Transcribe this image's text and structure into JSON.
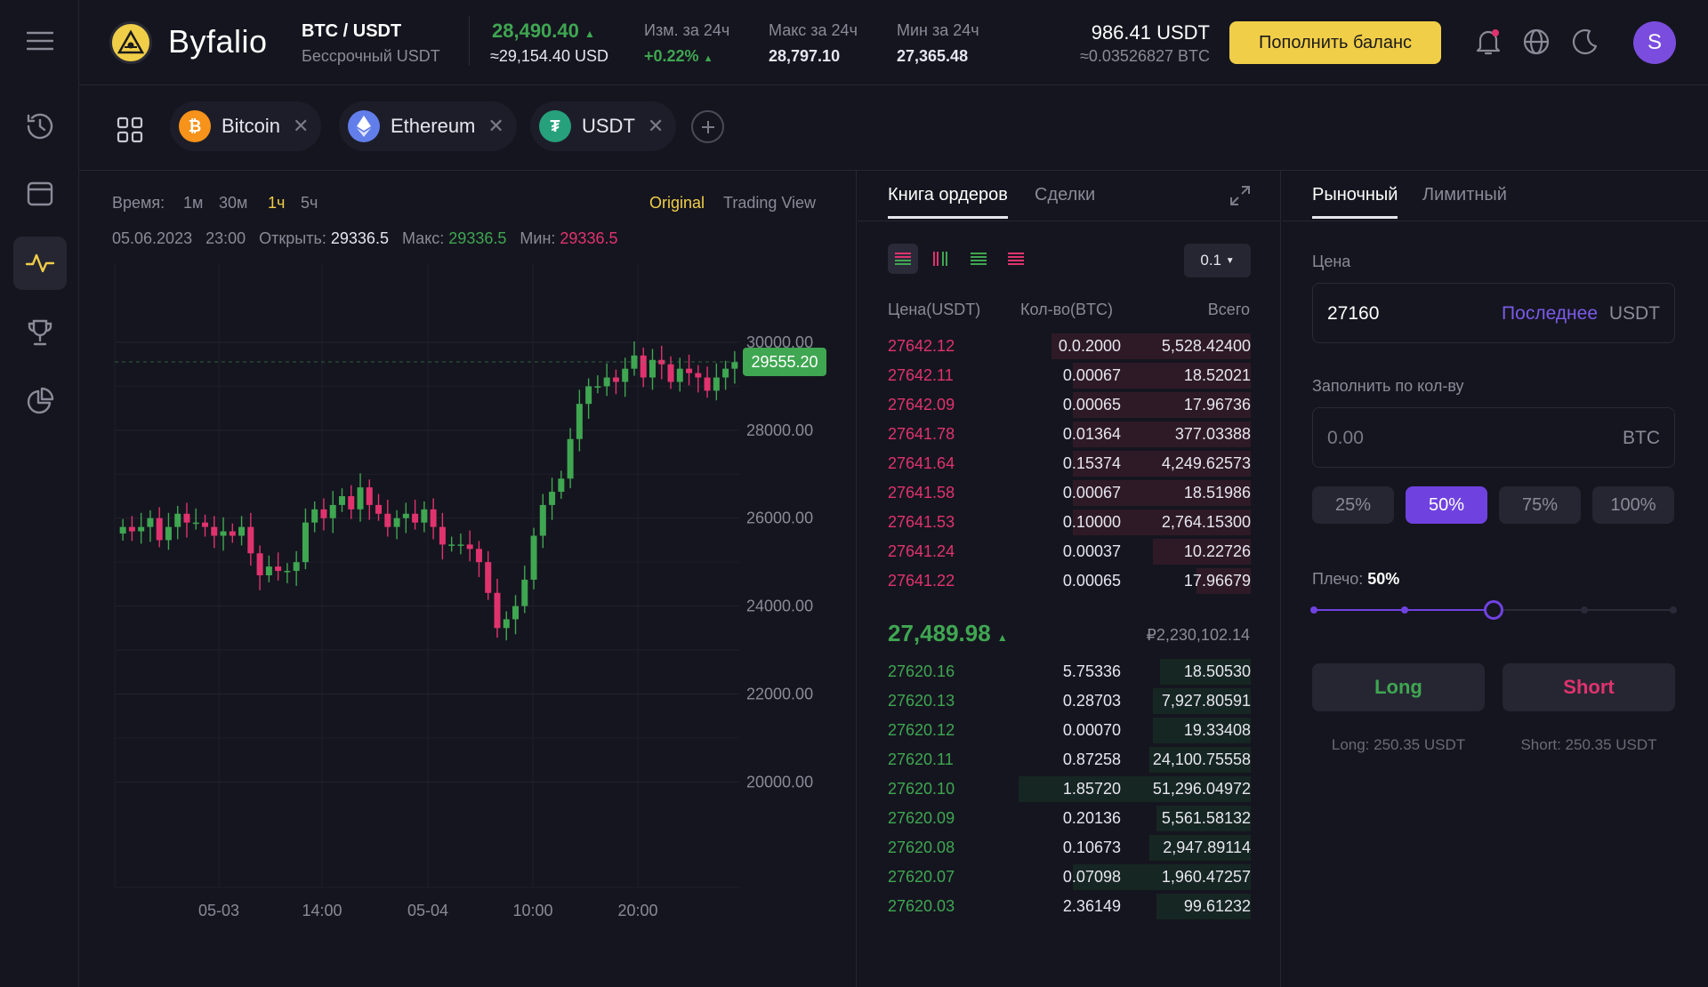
{
  "brand": {
    "name": "Byfalio"
  },
  "header": {
    "pair": "BTC / USDT",
    "pair_sub": "Бессрочный USDT",
    "last_price": "28,490.40",
    "last_price_usd": "≈29,154.40 USD",
    "change_label": "Изм. за 24ч",
    "change_value": "+0.22%",
    "high_label": "Макс за 24ч",
    "high_value": "28,797.10",
    "low_label": "Мин за 24ч",
    "low_value": "27,365.48",
    "balance": "986.41 USDT",
    "balance_btc": "≈0.03526827 BTC",
    "deposit_label": "Пополнить баланс",
    "avatar_letter": "S"
  },
  "tabs": {
    "coins": [
      {
        "label": "Bitcoin",
        "icon": "bitcoin-icon",
        "color": "#f7931a"
      },
      {
        "label": "Ethereum",
        "icon": "ethereum-icon",
        "color": "#627eea"
      },
      {
        "label": "USDT",
        "icon": "tether-icon",
        "color": "#26a17b"
      }
    ]
  },
  "chart_panel": {
    "time_label": "Время:",
    "timeframes": [
      "1м",
      "30м",
      "1ч",
      "5ч"
    ],
    "active_timeframe": "1ч",
    "view_original": "Original",
    "view_tradingview": "Trading View",
    "ohlc_date": "05.06.2023",
    "ohlc_time": "23:00",
    "open_label": "Открыть:",
    "open_value": "29336.5",
    "high_label": "Макс:",
    "high_value": "29336.5",
    "low_label": "Мин:",
    "low_value": "29336.5",
    "current_price_tag": "29555.20"
  },
  "chart_data": {
    "type": "candlestick",
    "x_tick_labels": [
      "05-03",
      "14:00",
      "05-04",
      "10:00",
      "20:00"
    ],
    "y_tick_labels": [
      "30000.00",
      "28000.00",
      "26000.00",
      "24000.00",
      "22000.00",
      "20000.00"
    ],
    "ylim": [
      17600,
      31800
    ],
    "grid": true,
    "current_price": 29555.2,
    "closes": [
      25800,
      25700,
      25800,
      26000,
      25500,
      25800,
      26100,
      25900,
      25900,
      25800,
      25600,
      25700,
      25600,
      25800,
      25200,
      24700,
      24900,
      24800,
      24800,
      25000,
      25900,
      26200,
      26000,
      26300,
      26500,
      26200,
      26700,
      26300,
      26100,
      25800,
      26000,
      26100,
      25900,
      26200,
      25800,
      25400,
      25400,
      25400,
      25300,
      25000,
      24300,
      23500,
      23700,
      24000,
      24600,
      25600,
      26300,
      26600,
      26900,
      27800,
      28600,
      29000,
      29000,
      29200,
      29100,
      29400,
      29700,
      29200,
      29600,
      29500,
      29100,
      29400,
      29300,
      29200,
      28900,
      29200,
      29400,
      29550
    ],
    "up_color": "#3fa651",
    "down_color": "#e0336e"
  },
  "orderbook": {
    "tab_book": "Книга ордеров",
    "tab_trades": "Сделки",
    "precision": "0.1",
    "col_price": "Цена(USDT)",
    "col_qty": "Кол-во(BTC)",
    "col_total": "Всего",
    "asks": [
      {
        "price": "27642.12",
        "qty": "0.0.2000",
        "total": "5,528.42400",
        "depth": 0.55
      },
      {
        "price": "27642.11",
        "qty": "0.00067",
        "total": "18.52021",
        "depth": 0.49
      },
      {
        "price": "27642.09",
        "qty": "0.00065",
        "total": "17.96736",
        "depth": 0.49
      },
      {
        "price": "27641.78",
        "qty": "0.01364",
        "total": "377.03388",
        "depth": 0.49
      },
      {
        "price": "27641.64",
        "qty": "0.15374",
        "total": "4,249.62573",
        "depth": 0.49
      },
      {
        "price": "27641.58",
        "qty": "0.00067",
        "total": "18.51986",
        "depth": 0.49
      },
      {
        "price": "27641.53",
        "qty": "0.10000",
        "total": "2,764.15300",
        "depth": 0.49
      },
      {
        "price": "27641.24",
        "qty": "0.00037",
        "total": "10.22726",
        "depth": 0.27
      },
      {
        "price": "27641.22",
        "qty": "0.00065",
        "total": "17.96679",
        "depth": 0.15
      }
    ],
    "mid_price": "27,489.98",
    "mid_rub": "₽2,230,102.14",
    "bids": [
      {
        "price": "27620.16",
        "qty": "5.75336",
        "total": "18.50530",
        "depth": 0.25
      },
      {
        "price": "27620.13",
        "qty": "0.28703",
        "total": "7,927.80591",
        "depth": 0.27
      },
      {
        "price": "27620.12",
        "qty": "0.00070",
        "total": "19.33408",
        "depth": 0.27
      },
      {
        "price": "27620.11",
        "qty": "0.87258",
        "total": "24,100.75558",
        "depth": 0.28
      },
      {
        "price": "27620.10",
        "qty": "1.85720",
        "total": "51,296.04972",
        "depth": 0.64
      },
      {
        "price": "27620.09",
        "qty": "0.20136",
        "total": "5,561.58132",
        "depth": 0.26
      },
      {
        "price": "27620.08",
        "qty": "0.10673",
        "total": "2,947.89114",
        "depth": 0.28
      },
      {
        "price": "27620.07",
        "qty": "0.07098",
        "total": "1,960.47257",
        "depth": 0.49
      },
      {
        "price": "27620.03",
        "qty": "2.36149",
        "total": "99.61232",
        "depth": 0.26
      }
    ]
  },
  "orderform": {
    "tab_market": "Рыночный",
    "tab_limit": "Лимитный",
    "price_label": "Цена",
    "price_value": "27160",
    "price_last": "Последнее",
    "price_unit": "USDT",
    "qty_label": "Заполнить по кол-ву",
    "qty_placeholder": "0.00",
    "qty_unit": "BTC",
    "percents": [
      "25%",
      "50%",
      "75%",
      "100%"
    ],
    "active_percent": "50%",
    "leverage_label": "Плечо:",
    "leverage_value": "50%",
    "leverage_fraction": 0.5,
    "long_label": "Long",
    "short_label": "Short",
    "long_info": "Long: 250.35 USDT",
    "short_info": "Short: 250.35 USDT"
  }
}
